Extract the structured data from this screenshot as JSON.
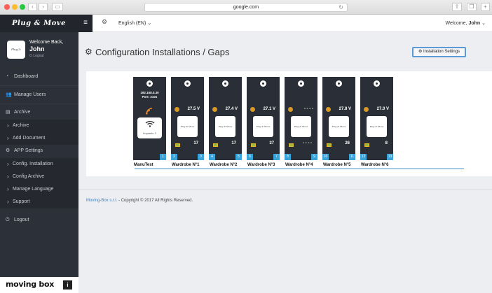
{
  "browser": {
    "url": "google.com"
  },
  "sidebar": {
    "brand_logo": "Plug & Move",
    "welcome_label": "Welcome Back,",
    "user_name": "John",
    "logout_small": "Logout",
    "items": [
      {
        "label": "Dashboard",
        "icon": "dashboard-icon"
      },
      {
        "label": "Manage Users",
        "icon": "users-icon"
      },
      {
        "label": "Archive",
        "icon": "archive-icon"
      },
      {
        "label": "Archive",
        "icon": "chevron-right-icon"
      },
      {
        "label": "Add Document",
        "icon": "chevron-right-icon"
      },
      {
        "label": "APP Settings",
        "icon": "gears-icon"
      },
      {
        "label": "Config. Installation",
        "icon": "chevron-right-icon"
      },
      {
        "label": "Config Archive",
        "icon": "chevron-right-icon"
      },
      {
        "label": "Manage Language",
        "icon": "chevron-right-icon"
      },
      {
        "label": "Support",
        "icon": "chevron-right-icon"
      },
      {
        "label": "Logout",
        "icon": "power-icon"
      }
    ],
    "footer_brand": "moving box"
  },
  "topbar": {
    "language": "English (EN)",
    "welcome": "Welcome,",
    "user": "John"
  },
  "main": {
    "title": "Configuration Installations / Gaps",
    "settings_button": "Installation Settings",
    "hub": {
      "label": "ManuTest",
      "ip": "192.168.0.30",
      "port": "Port: 2101",
      "device_label": "Impianto 2",
      "badge": "1"
    },
    "wardrobes": [
      {
        "label": "Wardrobe N°1",
        "temp": "27.5 V",
        "count": "17",
        "left": "2",
        "right": "3"
      },
      {
        "label": "Wardrobe N°2",
        "temp": "27.4 V",
        "count": "17",
        "left": "4",
        "right": "5"
      },
      {
        "label": "Wardrobe N°3",
        "temp": "27.1 V",
        "count": "37",
        "left": "6",
        "right": "7"
      },
      {
        "label": "Wardrobe N°4",
        "temp": "- - - -",
        "count": "- - - -",
        "left": "8",
        "right": "9"
      },
      {
        "label": "Wardrobe N°5",
        "temp": "27.8 V",
        "count": "26",
        "left": "10",
        "right": "11"
      },
      {
        "label": "Wardrobe N°6",
        "temp": "27.0 V",
        "count": "8",
        "left": "12",
        "right": "13"
      }
    ],
    "box_logo": "Plug & Move"
  },
  "footer": {
    "company": "Moving-Box s.r.l.",
    "copyright": " - Copyright © 2017 All Rights Reserved."
  },
  "colors": {
    "accent": "#3aa3d9",
    "sidebar": "#2c3038",
    "battery": "#8bc34a",
    "temp": "#d99a24"
  }
}
